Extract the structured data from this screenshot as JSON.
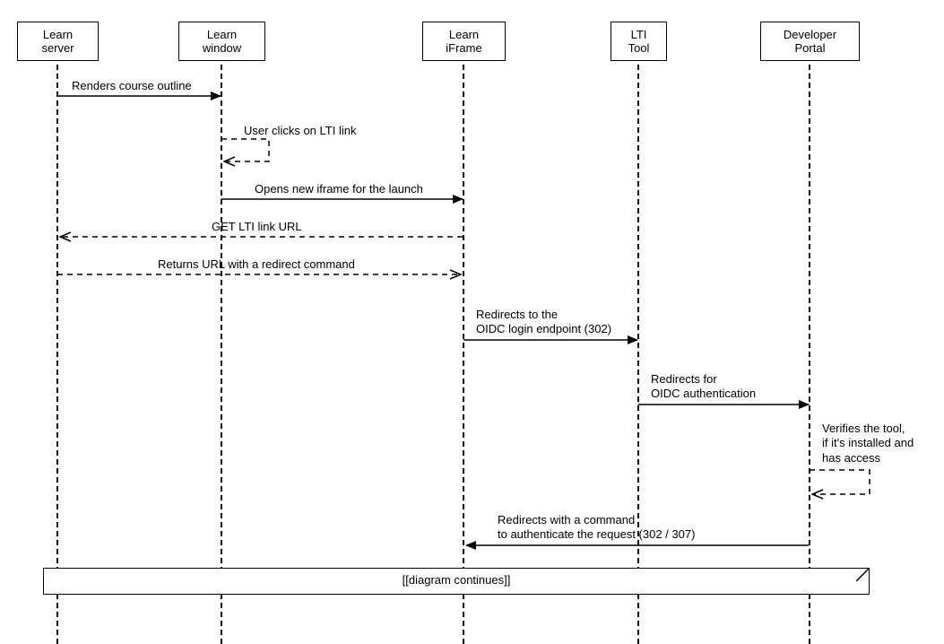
{
  "participants": {
    "learn_server": "Learn server",
    "learn_window": "Learn window",
    "learn_iframe": "Learn iFrame",
    "lti_tool": "LTI Tool",
    "developer_portal": "Developer Portal"
  },
  "messages": {
    "renders_course": "Renders course outline",
    "user_clicks": "User clicks on LTI link",
    "opens_iframe": "Opens new iframe for the launch",
    "get_lti_url": "GET LTI link URL",
    "returns_url": "Returns URL with a redirect command",
    "redirect_oidc_login_l1": "Redirects to the",
    "redirect_oidc_login_l2": "OIDC login endpoint (302)",
    "redirect_oidc_auth_l1": "Redirects for",
    "redirect_oidc_auth_l2": "OIDC authentication",
    "verifies_l1": "Verifies the tool,",
    "verifies_l2": "if it's installed and",
    "verifies_l3": "has access",
    "redirect_auth_req_l1": "Redirects with a command",
    "redirect_auth_req_l2": "to authenticate the request (302 / 307)"
  },
  "fragment": {
    "continues": "[[diagram continues]]"
  }
}
